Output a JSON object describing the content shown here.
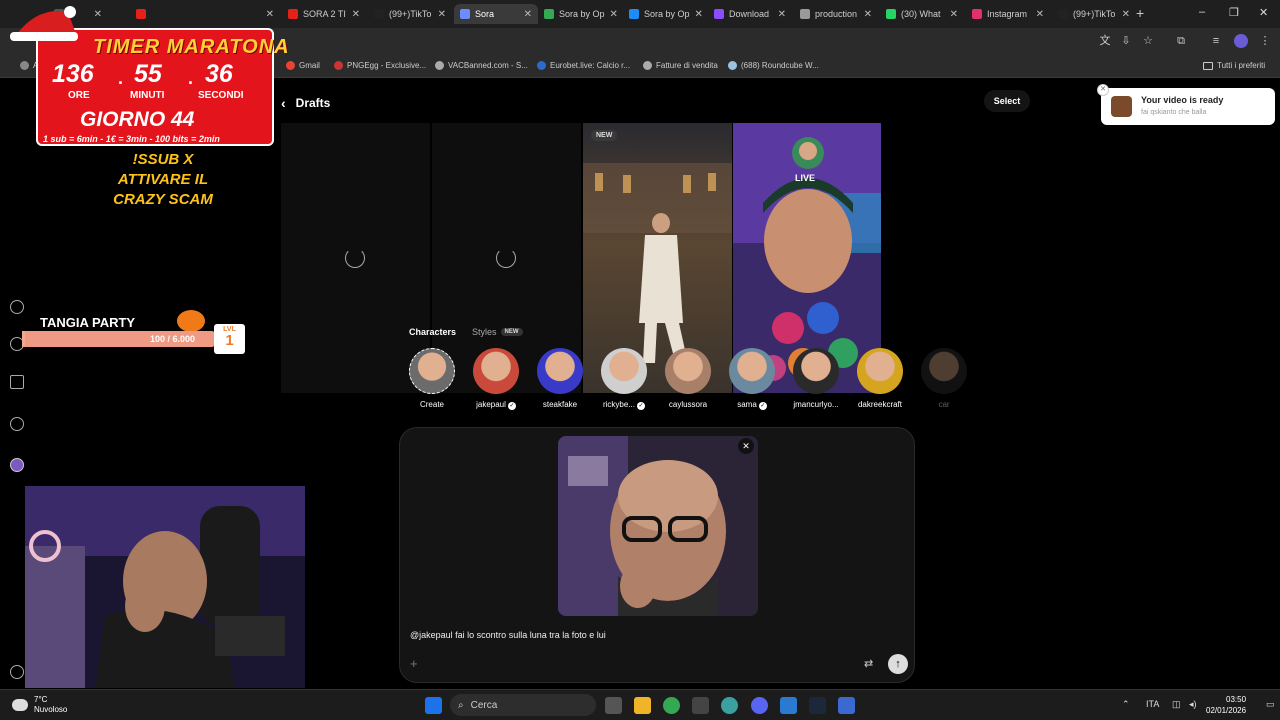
{
  "browser": {
    "tabs": [
      {
        "label": "",
        "icon": "tiktok-icon",
        "color": "#555"
      },
      {
        "label": "",
        "icon": "youtube-icon",
        "color": "#e62117"
      },
      {
        "label": "SORA 2 TI",
        "icon": "youtube-icon",
        "color": "#e62117"
      },
      {
        "label": "(99+)TikTo",
        "icon": "tiktok-icon",
        "color": "#222"
      },
      {
        "label": "Sora",
        "icon": "sora-icon",
        "color": "#6c8cff"
      },
      {
        "label": "Sora by Op",
        "icon": "google-play-icon",
        "color": "#34a853"
      },
      {
        "label": "Sora by Op",
        "icon": "app-store-icon",
        "color": "#1d8cf8"
      },
      {
        "label": "Download",
        "icon": "tiktok-icon",
        "color": "#8a4dff"
      },
      {
        "label": "production",
        "icon": "web-icon",
        "color": "#999"
      },
      {
        "label": "(30) What",
        "icon": "whatsapp-icon",
        "color": "#25d366"
      },
      {
        "label": "Instagram",
        "icon": "instagram-icon",
        "color": "#e1306c"
      },
      {
        "label": "(99+)TikTo",
        "icon": "tiktok-icon",
        "color": "#222"
      }
    ],
    "active_tab": 4,
    "bookmarks": [
      {
        "label": "App",
        "color": "#888"
      },
      {
        "label": "Gmail",
        "color": "#ea4335"
      },
      {
        "label": "PNGEgg - Exclusive...",
        "color": "#cc3333"
      },
      {
        "label": "VACBanned.com - S...",
        "color": "#aaaaaa"
      },
      {
        "label": "Eurobet.live: Calcio r...",
        "color": "#2a6cc9"
      },
      {
        "label": "Fatture di vendita",
        "color": "#aaaaaa"
      },
      {
        "label": "(688) Roundcube W...",
        "color": "#9bc1e0"
      }
    ],
    "all_bookmarks_label": "Tutti i preferiti"
  },
  "sora": {
    "page_title": "Drafts",
    "select_label": "Select",
    "new_badge": "NEW",
    "live_badge": "LIVE",
    "characters_label": "Characters",
    "styles_label": "Styles",
    "styles_badge": "NEW",
    "characters": [
      {
        "name": "Create",
        "verified": false,
        "color": "#6b6b6b"
      },
      {
        "name": "jakepaul",
        "verified": true,
        "color": "#c94a3a"
      },
      {
        "name": "steakfake",
        "verified": false,
        "color": "#3a3ac9"
      },
      {
        "name": "rickybe...",
        "verified": true,
        "color": "#cfcfcf"
      },
      {
        "name": "caylussora",
        "verified": false,
        "color": "#a8806a"
      },
      {
        "name": "sama",
        "verified": true,
        "color": "#6b8aa0"
      },
      {
        "name": "jmancurlyo...",
        "verified": false,
        "color": "#2a2a2a"
      },
      {
        "name": "dakreekcraft",
        "verified": false,
        "color": "#d5a520"
      },
      {
        "name": "car",
        "verified": false,
        "color": "#333"
      }
    ],
    "prompt": "@jakepaul fai lo scontro sulla luna tra la foto e lui",
    "toast_title": "Your video is ready",
    "toast_subtitle": "fai qskianto che balla"
  },
  "overlay": {
    "timer_title": "TIMER MARATONA",
    "hours": "136",
    "minutes": "55",
    "seconds": "36",
    "hours_label": "ORE",
    "minutes_label": "MINUTI",
    "seconds_label": "SECONDI",
    "day": "GIORNO 44",
    "rules": "1 sub = 6min - 1€ = 3min - 100 bits = 2min",
    "scam_text": [
      "!SSUB X",
      "ATTIVARE IL",
      "CRAZY SCAM"
    ],
    "party_title": "TANGIA PARTY",
    "party_progress": "100 / 6.000",
    "party_progress_fraction": 0.017,
    "level_label": "LVL",
    "level": "1"
  },
  "taskbar": {
    "temperature": "7°C",
    "weather": "Nuvoloso",
    "search_placeholder": "Cerca",
    "language": "ITA",
    "time": "03:50",
    "date": "02/01/2026"
  }
}
